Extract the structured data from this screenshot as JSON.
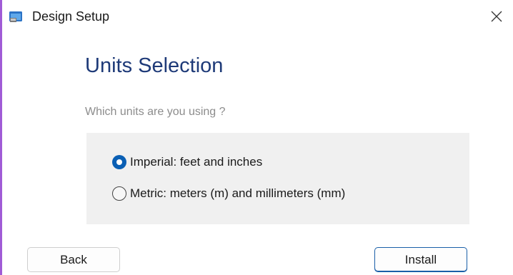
{
  "window": {
    "title": "Design Setup",
    "app_icon": "installer-app-icon",
    "close_icon": "close-icon",
    "accent_border_color": "#a05bd6"
  },
  "page": {
    "heading": "Units Selection",
    "question": "Which units are you using ?",
    "heading_color": "#1e3a78"
  },
  "units": {
    "options": [
      {
        "label": "Imperial: feet and inches",
        "selected": true
      },
      {
        "label": "Metric: meters (m) and millimeters (mm)",
        "selected": false
      }
    ],
    "radio_checked_color": "#0a5fb4"
  },
  "buttons": {
    "back_label": "Back",
    "install_label": "Install"
  }
}
